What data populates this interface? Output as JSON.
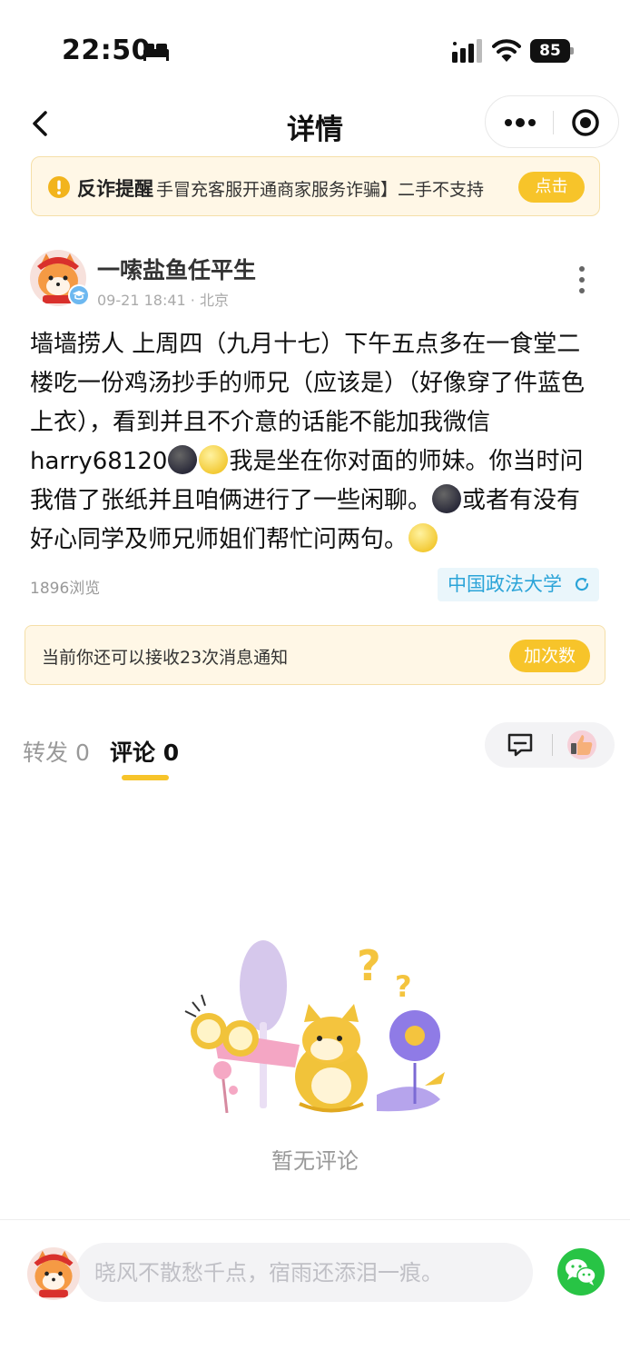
{
  "status_bar": {
    "time": "22:50",
    "battery": "85"
  },
  "nav": {
    "title": "详情"
  },
  "alert": {
    "title": "反诈提醒",
    "text": "手冒充客服开通商家服务诈骗】二手不支持",
    "button": "点击"
  },
  "post": {
    "username": "一嗦盐鱼任平生",
    "meta": "09-21 18:41 · 北京",
    "body_part1": "墙墙捞人 上周四（九月十七）下午五点多在一食堂二楼吃一份鸡汤抄手的师兄（应该是）（好像穿了件蓝色上衣），看到并且不介意的话能不能加我微信harry68120",
    "body_part2": "我是坐在你对面的师妹。你当时问我借了张纸并且咱俩进行了一些闲聊。",
    "body_part3": "或者有没有好心同学及师兄师姐们帮忙问两句。",
    "views": "1896浏览",
    "school": "中国政法大学"
  },
  "notice": {
    "text": "当前你还可以接收23次消息通知",
    "button": "加次数"
  },
  "tabs": {
    "repost": "转发 0",
    "comment": "评论 0"
  },
  "empty": {
    "text": "暂无评论"
  },
  "comment_box": {
    "placeholder": "晓风不散愁千点，宿雨还添泪一痕。"
  },
  "colors": {
    "accent": "#f7c42a",
    "tag_blue": "#2ba4d8",
    "wechat_green": "#28c445"
  }
}
